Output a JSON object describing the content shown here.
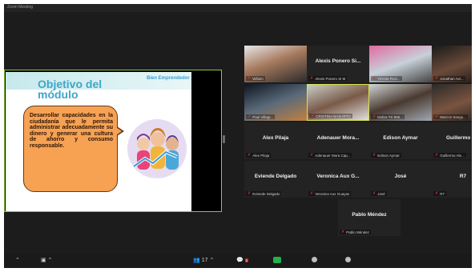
{
  "window": {
    "title": "Zoom Meeting"
  },
  "slide": {
    "title": "Objetivo del módulo",
    "brand": "Bien Emprendedor",
    "bubble_text": "Desarrollar capacidades en la ciudadanía que le permita administrar adecuadamente su dinero y generar una cultura de ahorro y consumo responsable."
  },
  "participants": [
    {
      "name": "",
      "tag": "Wiliam",
      "video": true
    },
    {
      "name": "Alexis Ponero Si...",
      "tag": "Alexis Ponero Si M",
      "video": false
    },
    {
      "name": "",
      "tag": "Yessita Rosi...",
      "video": true
    },
    {
      "name": "",
      "tag": "Jonathan Avi...",
      "video": true
    },
    {
      "name": "",
      "tag": "Paul Villagr...",
      "video": true
    },
    {
      "name": "",
      "tag": "CRISTINA BASURTO",
      "video": true,
      "active": true
    },
    {
      "name": "",
      "tag": "Debra TS 906...",
      "video": true
    },
    {
      "name": "",
      "tag": "Marcos Sangu...",
      "video": true
    },
    {
      "name": "Alex Pilaja",
      "tag": "Alex Pilaja",
      "video": false
    },
    {
      "name": "Adenauer Mora...",
      "tag": "Adenauer Mora Cap...",
      "video": false
    },
    {
      "name": "Edison Aymar",
      "tag": "Edison Aymar",
      "video": false
    },
    {
      "name": "Guillermo A...",
      "tag": "Guillermo Ale...",
      "video": false
    },
    {
      "name": "Eviende Delgado",
      "tag": "Eviende Delgado",
      "video": false
    },
    {
      "name": "Veronica Aux G...",
      "tag": "Veronica Aux Guayas",
      "video": false
    },
    {
      "name": "José",
      "tag": "José",
      "video": false
    },
    {
      "name": "R7",
      "tag": "R7",
      "video": false
    },
    {
      "name": "Pablo Méndez",
      "tag": "Pablo Méndez",
      "video": false
    }
  ],
  "toolbar": {
    "participants_count": "17",
    "chat_badge": "1"
  }
}
